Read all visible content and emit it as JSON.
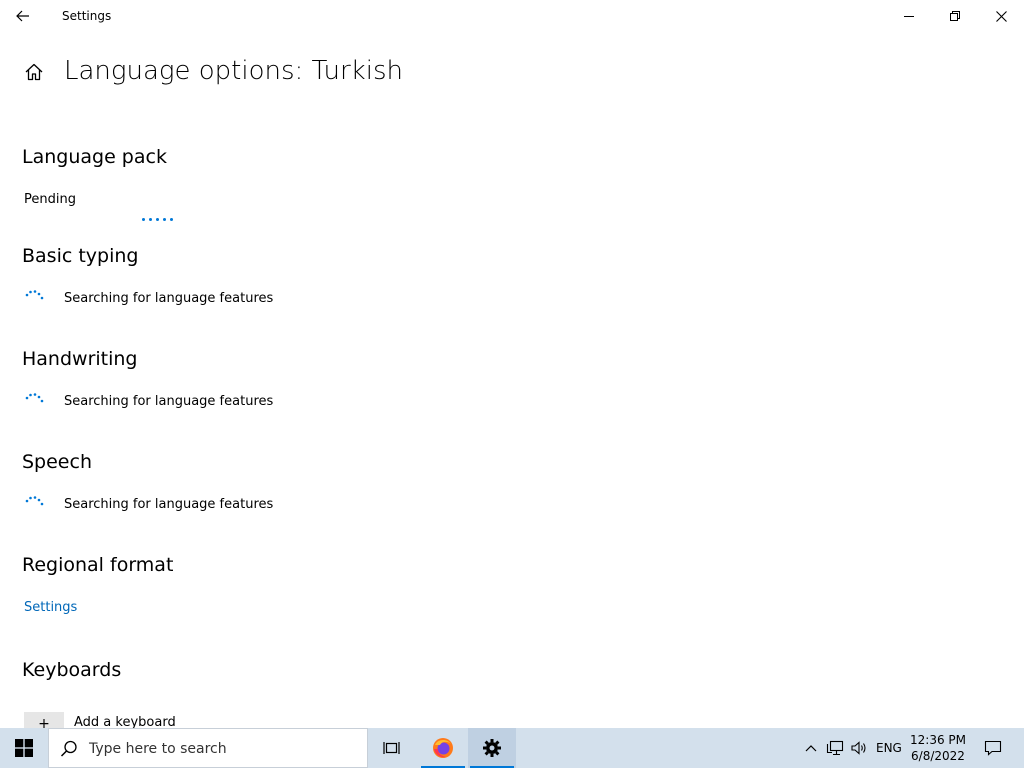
{
  "window": {
    "app_title": "Settings",
    "page_title": "Language options: Turkish"
  },
  "sections": {
    "language_pack": {
      "heading": "Language pack",
      "status": "Pending"
    },
    "basic_typing": {
      "heading": "Basic typing",
      "status": "Searching for language features"
    },
    "handwriting": {
      "heading": "Handwriting",
      "status": "Searching for language features"
    },
    "speech": {
      "heading": "Speech",
      "status": "Searching for language features"
    },
    "regional_format": {
      "heading": "Regional format",
      "link": "Settings"
    },
    "keyboards": {
      "heading": "Keyboards",
      "add_label": "Add a keyboard",
      "add_symbol": "+"
    }
  },
  "taskbar": {
    "search_placeholder": "Type here to search",
    "tray_language": "ENG",
    "clock_time": "12:36 PM",
    "clock_date": "6/8/2022",
    "pinned": [
      "task-view-icon",
      "firefox-icon",
      "settings-gear-icon"
    ]
  },
  "colors": {
    "accent": "#0078d7",
    "link": "#0067b8",
    "taskbar": "#d3e0ec"
  }
}
